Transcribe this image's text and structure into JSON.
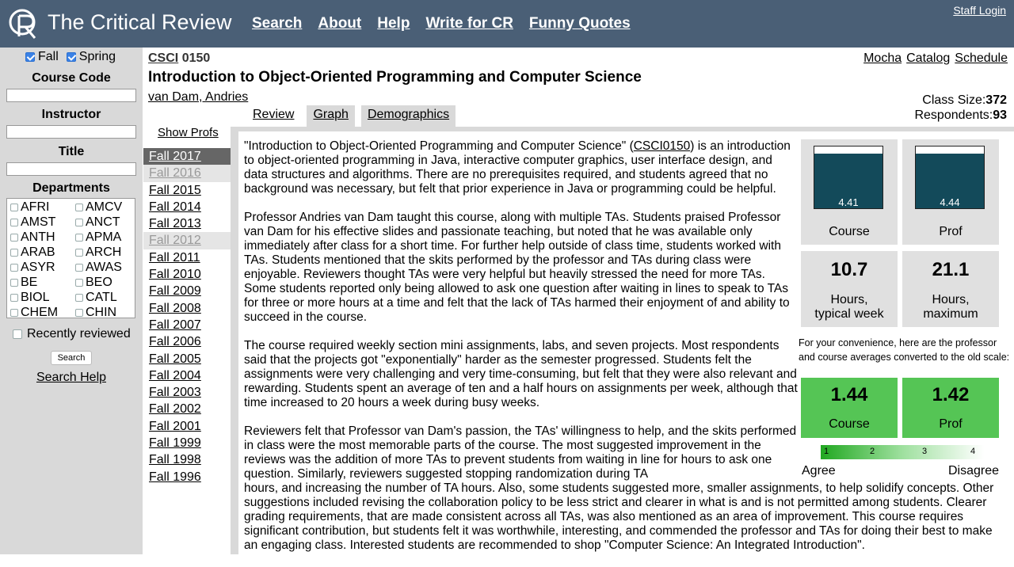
{
  "header": {
    "logo_text": "CR",
    "site_title": "The Critical Review",
    "nav": [
      "Search",
      "About",
      "Help",
      "Write for CR",
      "Funny Quotes"
    ],
    "staff_login": "Staff Login"
  },
  "sidebar": {
    "fall_label": "Fall",
    "spring_label": "Spring",
    "course_code_label": "Course Code",
    "instructor_label": "Instructor",
    "title_label": "Title",
    "departments_label": "Departments",
    "departments": [
      "AFRI",
      "AMCV",
      "AMST",
      "ANCT",
      "ANTH",
      "APMA",
      "ARAB",
      "ARCH",
      "ASYR",
      "AWAS",
      "BE",
      "BEO",
      "BIOL",
      "CATL",
      "CHEM",
      "CHIN"
    ],
    "recently_reviewed": "Recently reviewed",
    "search_button": "Search",
    "search_help": "Search Help"
  },
  "course": {
    "dept": "CSCI",
    "number": "0150",
    "title": "Introduction to Object-Oriented Programming and Computer Science",
    "instructor": "van Dam, Andries",
    "links": [
      "Mocha",
      "Catalog",
      "Schedule"
    ],
    "class_size_label": "Class Size:",
    "class_size": "372",
    "respondents_label": "Respondents:",
    "respondents": "93"
  },
  "tabs": [
    "Review",
    "Graph",
    "Demographics"
  ],
  "show_profs": "Show Profs",
  "semesters": [
    {
      "label": "Fall 2017",
      "state": "active"
    },
    {
      "label": "Fall 2016",
      "state": "muted"
    },
    {
      "label": "Fall 2015",
      "state": ""
    },
    {
      "label": "Fall 2014",
      "state": ""
    },
    {
      "label": "Fall 2013",
      "state": ""
    },
    {
      "label": "Fall 2012",
      "state": "muted"
    },
    {
      "label": "Fall 2011",
      "state": ""
    },
    {
      "label": "Fall 2010",
      "state": ""
    },
    {
      "label": "Fall 2009",
      "state": ""
    },
    {
      "label": "Fall 2008",
      "state": ""
    },
    {
      "label": "Fall 2007",
      "state": ""
    },
    {
      "label": "Fall 2006",
      "state": ""
    },
    {
      "label": "Fall 2005",
      "state": ""
    },
    {
      "label": "Fall 2004",
      "state": ""
    },
    {
      "label": "Fall 2003",
      "state": ""
    },
    {
      "label": "Fall 2002",
      "state": ""
    },
    {
      "label": "Fall 2001",
      "state": ""
    },
    {
      "label": "Fall 1999",
      "state": ""
    },
    {
      "label": "Fall 1998",
      "state": ""
    },
    {
      "label": "Fall 1996",
      "state": ""
    }
  ],
  "review": {
    "p1_before": "\"Introduction to Object-Oriented Programming and Computer Science\" (",
    "p1_link": "CSCI0150",
    "p1_after": ") is an introduction to object-oriented programming in Java, interactive computer graphics, user interface design, and data structures and algorithms. There are no prerequisites required, and students agreed that no background was necessary, but felt that prior experience in Java or programming could be helpful.",
    "p2": "Professor Andries van Dam taught this course, along with multiple TAs. Students praised Professor van Dam for his effective slides and passionate teaching, but noted that he was available only immediately after class for a short time. For further help outside of class time, students worked with TAs. Students mentioned that the skits performed by the professor and TAs during class were enjoyable. Reviewers thought TAs were very helpful but heavily stressed the need for more TAs. Some students reported only being allowed to ask one question after waiting in lines to speak to TAs for three or more hours at a time and felt that the lack of TAs harmed their enjoyment of and ability to succeed in the course.",
    "p3": "The course required weekly section mini assignments, labs, and seven projects. Most respondents said that the projects got \"exponentially\" harder as the semester progressed. Students felt the assignments were very challenging and very time-consuming, but felt that they were also relevant and rewarding. Students spent an average of ten and a half hours on assignments per week, although that time increased to 20 hours a week during busy weeks.",
    "p4a": "Reviewers felt that Professor van Dam's passion, the TAs' willingness to help, and the skits performed in class were the most memorable parts of the course. The most suggested improvement in the reviews was the addition of more TAs to prevent students from waiting in line for hours to ask one question. Similarly, reviewers suggested stopping randomization during TA",
    "p4b": "hours, and increasing the number of TA hours. Also, some students suggested more, smaller assignments, to help solidify concepts. Other suggestions included revising the collaboration policy to be less strict and clearer in what is and is not permitted among students. Clearer grading requirements, that are made consistent across all TAs, was also mentioned as an area of improvement. This course requires significant contribution, but students felt it was worthwhile, interesting, and commended the professor and TAs for doing their best to make an engaging class. Interested students are recommended to shop \"Computer Science: An Integrated Introduction\"."
  },
  "stats": {
    "course_score": "4.41",
    "course_fraction": 0.882,
    "course_label": "Course",
    "prof_score": "4.44",
    "prof_fraction": 0.888,
    "prof_label": "Prof",
    "hours_typical": "10.7",
    "hours_typical_label_1": "Hours,",
    "hours_typical_label_2": "typical week",
    "hours_max": "21.1",
    "hours_max_label_1": "Hours,",
    "hours_max_label_2": "maximum",
    "convenience_note": "For your convenience, here are the professor and course averages converted to the old scale:",
    "old_course": "1.44",
    "old_course_label": "Course",
    "old_prof": "1.42",
    "old_prof_label": "Prof",
    "scale_ticks": [
      "1",
      "2",
      "3",
      "4"
    ],
    "agree": "Agree",
    "disagree": "Disagree",
    "bar_color": "#134a5a",
    "green_color": "#55c555"
  }
}
